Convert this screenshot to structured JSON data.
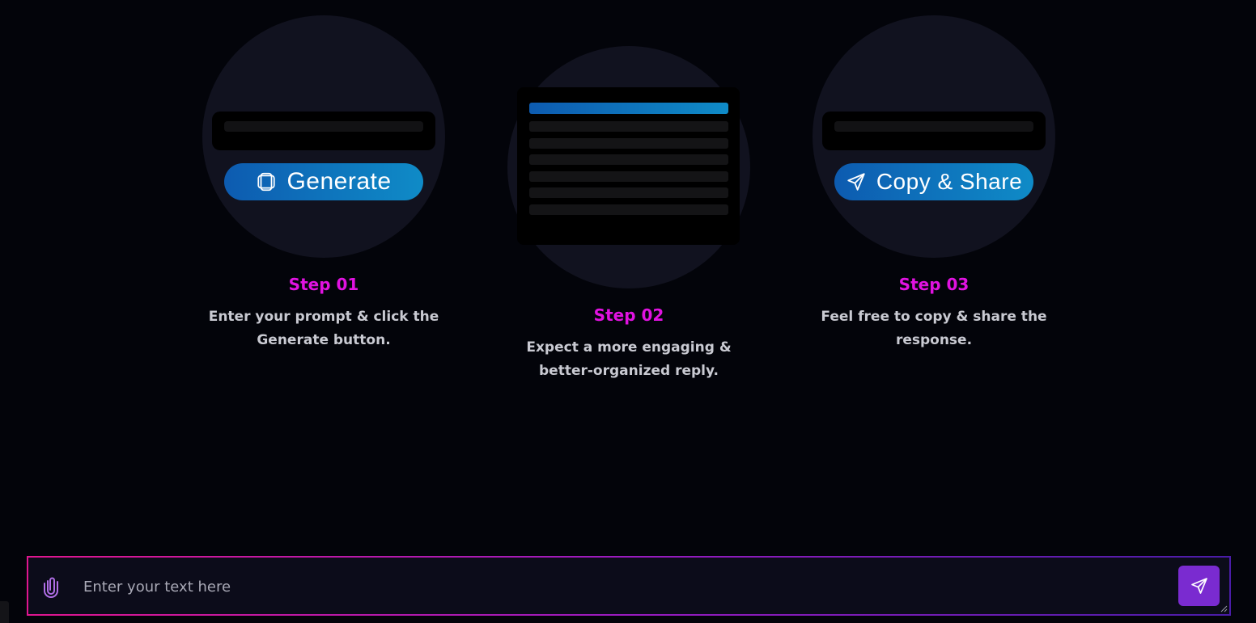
{
  "steps": [
    {
      "title": "Step 01",
      "description": "Enter your prompt & click the Generate button.",
      "button_label": "Generate",
      "button_icon": "layers-icon"
    },
    {
      "title": "Step 02",
      "description": "Expect a more engaging & better-organized reply."
    },
    {
      "title": "Step 03",
      "description": "Feel free to copy & share the response.",
      "button_label": "Copy & Share",
      "button_icon": "send-icon"
    }
  ],
  "composer": {
    "placeholder": "Enter your text here",
    "attach_icon": "paperclip-icon",
    "send_icon": "send-icon"
  },
  "colors": {
    "accent_title": "#e112e1",
    "button_gradient_start": "#0d5bb0",
    "button_gradient_end": "#0f8bc7",
    "send_button": "#7a2bd0",
    "background": "#03040a"
  }
}
